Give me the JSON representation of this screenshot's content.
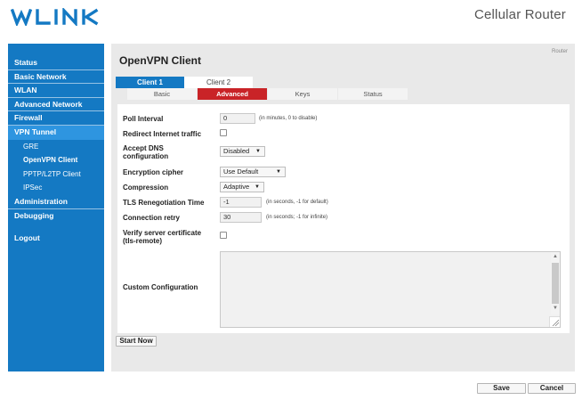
{
  "header": {
    "logo_text": "WLINK",
    "product_title": "Cellular Router"
  },
  "colors": {
    "brand": "#1479c3",
    "active_tab": "#c92327",
    "content_bg": "#e9e9e9"
  },
  "sidebar": {
    "items": [
      {
        "label": "Status"
      },
      {
        "label": "Basic Network"
      },
      {
        "label": "WLAN"
      },
      {
        "label": "Advanced Network"
      },
      {
        "label": "Firewall"
      },
      {
        "label": "VPN Tunnel"
      },
      {
        "label": "GRE"
      },
      {
        "label": "OpenVPN Client"
      },
      {
        "label": "PPTP/L2TP Client"
      },
      {
        "label": "IPSec"
      },
      {
        "label": "Administration"
      },
      {
        "label": "Debugging"
      },
      {
        "label": "Logout"
      }
    ]
  },
  "main": {
    "breadcrumb": "Router",
    "title": "OpenVPN Client",
    "client_tabs": [
      {
        "label": "Client 1"
      },
      {
        "label": "Client 2"
      }
    ],
    "sub_tabs": [
      {
        "label": "Basic"
      },
      {
        "label": "Advanced"
      },
      {
        "label": "Keys"
      },
      {
        "label": "Status"
      }
    ]
  },
  "form": {
    "poll_interval": {
      "label": "Poll Interval",
      "value": "0",
      "hint": "(in minutes, 0 to disable)"
    },
    "redirect_traffic": {
      "label": "Redirect Internet traffic",
      "checked": false
    },
    "accept_dns": {
      "label_line1": "Accept DNS",
      "label_line2": "configuration",
      "value": "Disabled"
    },
    "encryption_cipher": {
      "label": "Encryption cipher",
      "value": "Use Default"
    },
    "compression": {
      "label": "Compression",
      "value": "Adaptive"
    },
    "tls_renegotiation": {
      "label": "TLS Renegotiation Time",
      "value": "-1",
      "hint": "(in seconds, -1 for default)"
    },
    "connection_retry": {
      "label": "Connection retry",
      "value": "30",
      "hint": "(in seconds; -1 for infinite)"
    },
    "verify_cert": {
      "label_line1": "Verify server certificate",
      "label_line2": "(tls-remote)",
      "checked": false
    },
    "custom_config": {
      "label": "Custom Configuration",
      "value": ""
    }
  },
  "buttons": {
    "start_now": "Start Now",
    "save": "Save",
    "cancel": "Cancel"
  }
}
